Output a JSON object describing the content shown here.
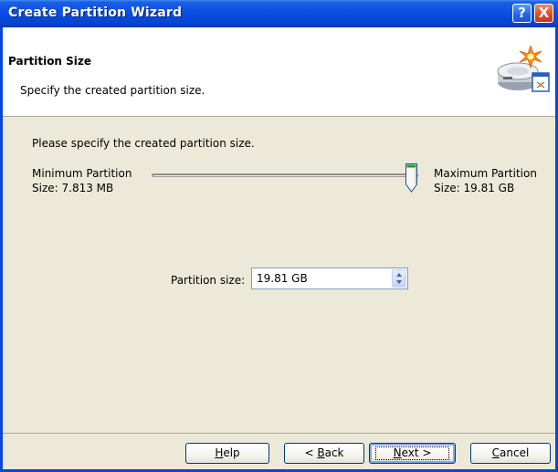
{
  "window": {
    "title": "Create Partition Wizard",
    "titlebar_buttons": {
      "help": "?",
      "close": "X"
    }
  },
  "header": {
    "title": "Partition Size",
    "subtitle": "Specify the created partition size.",
    "icon": "disk-partition-wizard-icon"
  },
  "body": {
    "instruction": "Please specify the created partition size.",
    "slider": {
      "min_label_line1": "Minimum Partition",
      "min_label_line2": "Size: 7.813 MB",
      "max_label_line1": "Maximum Partition",
      "max_label_line2": "Size: 19.81 GB",
      "position_fraction": 1.0
    },
    "partition_size": {
      "label": "Partition size:",
      "value": "19.81 GB"
    }
  },
  "footer": {
    "help": {
      "pre": "",
      "accel": "H",
      "post": "elp"
    },
    "back": {
      "pre": "< ",
      "accel": "B",
      "post": "ack"
    },
    "next": {
      "pre": "",
      "accel": "N",
      "post": "ext >"
    },
    "cancel": {
      "pre": "",
      "accel": "C",
      "post": "ancel"
    }
  },
  "colors": {
    "titlebar": "#0a51e4",
    "window_bg": "#ece9d8",
    "button_border": "#003c74"
  }
}
